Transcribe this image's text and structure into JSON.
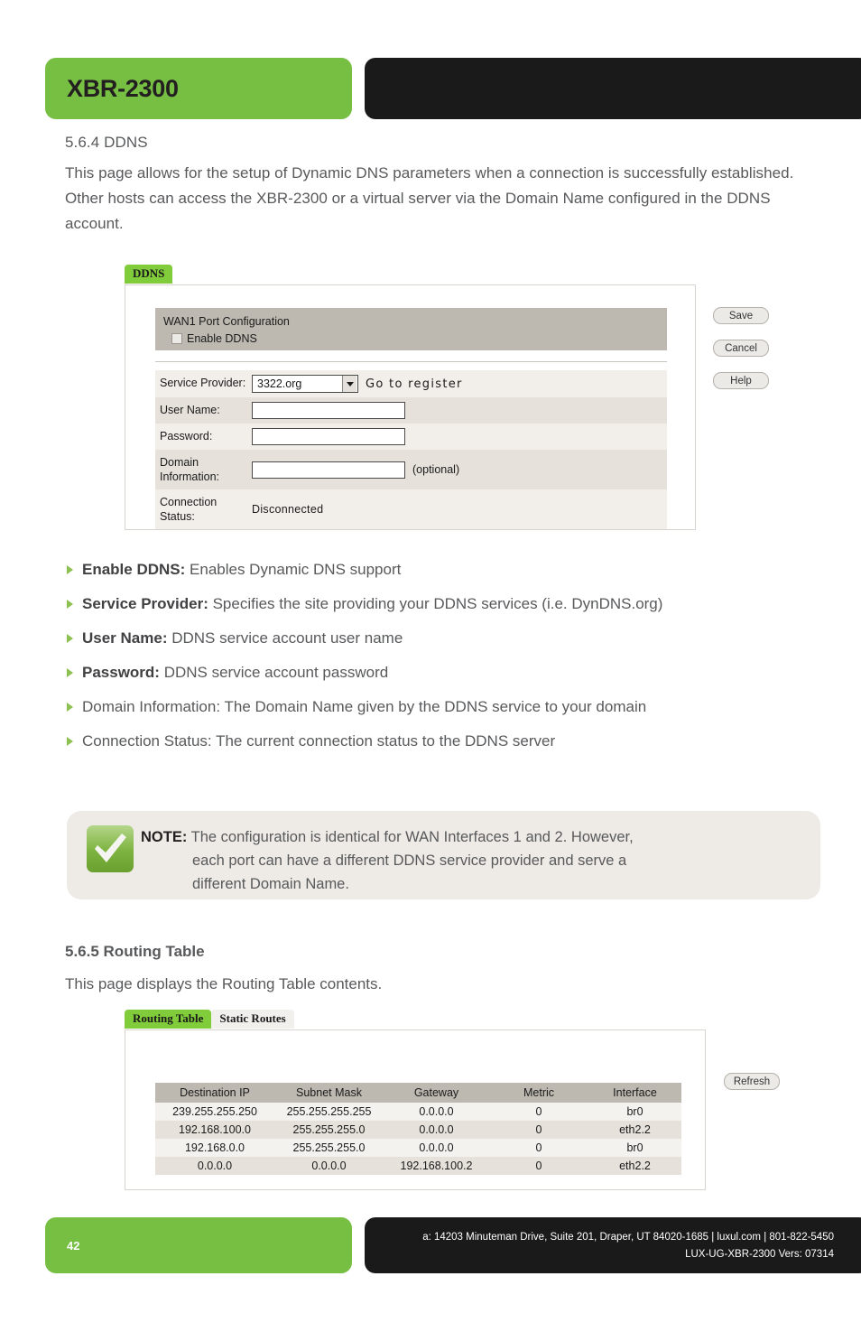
{
  "header": {
    "product_title": "XBR-2300"
  },
  "sections": {
    "ddns": {
      "heading": "5.6.4 DDNS",
      "paragraph": "This page allows for the setup of Dynamic DNS parameters when a connection is successfully established. Other hosts can access the XBR-2300 or a virtual server via the Domain Name configured in the DDNS account."
    },
    "routing": {
      "heading": "5.6.5 Routing Table",
      "paragraph": "This page displays the Routing Table contents."
    }
  },
  "ddns_screenshot": {
    "tab_label": "DDNS",
    "section_title": "WAN1 Port Configuration",
    "enable_checkbox_label": "Enable DDNS",
    "checkbox_checked": false,
    "fields": [
      {
        "label": "Service Provider:",
        "value": "3322.org",
        "suffix": "Go to register",
        "type": "select"
      },
      {
        "label": "User Name:",
        "value": "",
        "suffix": "",
        "type": "text"
      },
      {
        "label": "Password:",
        "value": "",
        "suffix": "",
        "type": "text"
      },
      {
        "label": "Domain Information:",
        "value": "",
        "suffix": "(optional)",
        "type": "text"
      },
      {
        "label": "Connection Status:",
        "value": "Disconnected",
        "suffix": "",
        "type": "static"
      }
    ],
    "buttons": [
      "Save",
      "Cancel",
      "Help"
    ]
  },
  "bullets": [
    {
      "term": "Enable DDNS:",
      "bold": true,
      "desc": " Enables Dynamic DNS support"
    },
    {
      "term": "Service Provider:",
      "bold": true,
      "desc": " Specifies the site providing your DDNS services (i.e. DynDNS.org)"
    },
    {
      "term": "User Name:",
      "bold": true,
      "desc": " DDNS service account user name"
    },
    {
      "term": "Password:",
      "bold": true,
      "desc": " DDNS service account password"
    },
    {
      "term": "Domain Information:",
      "bold": false,
      "desc": " The Domain Name given by the DDNS service to your domain"
    },
    {
      "term": "Connection Status:",
      "bold": false,
      "desc": " The current connection status to the DDNS server"
    }
  ],
  "note": {
    "icon": "green-check-icon",
    "label": "NOTE:",
    "line1": "The configuration is identical for WAN Interfaces 1 and 2. However,",
    "line2": "each port can have a different DDNS service provider and serve a",
    "line3": "different Domain Name."
  },
  "routing_screenshot": {
    "tabs": [
      {
        "label": "Routing Table",
        "active": true
      },
      {
        "label": "Static Routes",
        "active": false
      }
    ],
    "columns": [
      "Destination IP",
      "Subnet Mask",
      "Gateway",
      "Metric",
      "Interface"
    ],
    "rows": [
      [
        "239.255.255.250",
        "255.255.255.255",
        "0.0.0.0",
        "0",
        "br0"
      ],
      [
        "192.168.100.0",
        "255.255.255.0",
        "0.0.0.0",
        "0",
        "eth2.2"
      ],
      [
        "192.168.0.0",
        "255.255.255.0",
        "0.0.0.0",
        "0",
        "br0"
      ],
      [
        "0.0.0.0",
        "0.0.0.0",
        "192.168.100.2",
        "0",
        "eth2.2"
      ]
    ],
    "refresh_label": "Refresh"
  },
  "footer": {
    "page_number": "42",
    "address_line": "a: 14203 Minuteman Drive, Suite 201, Draper, UT 84020-1685 | luxul.com | 801-822-5450",
    "doc_line": "LUX-UG-XBR-2300  Vers: 07314"
  },
  "colors": {
    "brand_green": "#76bf43",
    "tab_green": "#80cc3a",
    "black_bar": "#1a1a1a",
    "body_text": "#58595b",
    "ui_header_gray": "#bdb9b1"
  }
}
